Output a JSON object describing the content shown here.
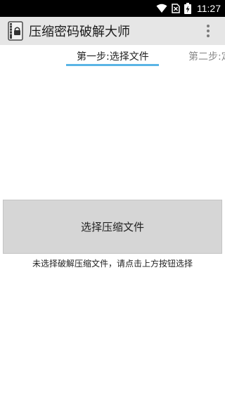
{
  "status_bar": {
    "time": "11:27",
    "icons": [
      "wifi-icon",
      "sim-no-signal-icon",
      "battery-charging-icon"
    ]
  },
  "app_bar": {
    "icon": "archive-lock-app-icon",
    "title": "压缩密码破解大师",
    "menu_icon": "overflow-menu-icon"
  },
  "tabs": [
    {
      "label": "第一步:选择文件",
      "selected": true
    },
    {
      "label": "第二步:定",
      "selected": false
    }
  ],
  "main": {
    "select_button_label": "选择压缩文件",
    "hint": "未选择破解压缩文件，请点击上方按钮选择"
  },
  "colors": {
    "status_bar_bg": "#000000",
    "app_bar_bg": "#e6e6e6",
    "tab_indicator": "#5ab4e5",
    "button_bg": "#d6d6d6"
  }
}
